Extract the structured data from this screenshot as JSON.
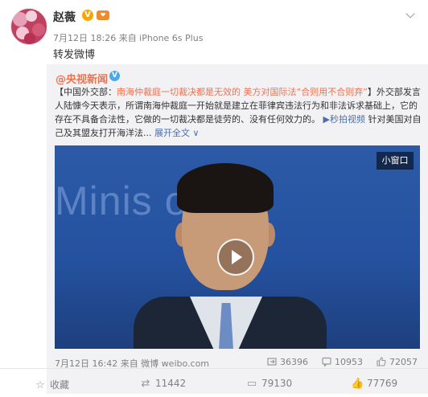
{
  "post": {
    "username": "赵薇",
    "meta": "7月12日 18:26 来自 iPhone 6s Plus",
    "text": "转发微博"
  },
  "quoted": {
    "author": "@央视新闻",
    "body_pre": "【中国外交部：",
    "body_link": "南海仲裁庭一切裁决都是无效的 美方对国际法“合则用不合则弃”",
    "body_rest": "】外交部发言人陆慷今天表示，所谓南海仲裁庭一开始就是建立在菲律宾违法行为和非法诉求基础上，它的存在不具备合法性，它做的一切裁决都是徒劳的、没有任何效力的。",
    "video_link": "秒拍视频",
    "body_tail": " 针对美国对自己及其盟友打开海洋法...",
    "expand": "展开全文",
    "video_bg_text": "Minis     of For",
    "mini_window": "小窗口",
    "meta": "7月12日 16:42 来自 微博 weibo.com",
    "reposts": "36396",
    "comments": "10953",
    "likes": "72057"
  },
  "actions": {
    "favorite": "收藏",
    "repost": "11442",
    "comment": "79130",
    "like": "77769"
  },
  "colors": {
    "accent": "#eb7350",
    "link": "#4e6ea5",
    "verified_gold": "#f7a700",
    "verified_blue": "#4ea8e8"
  }
}
